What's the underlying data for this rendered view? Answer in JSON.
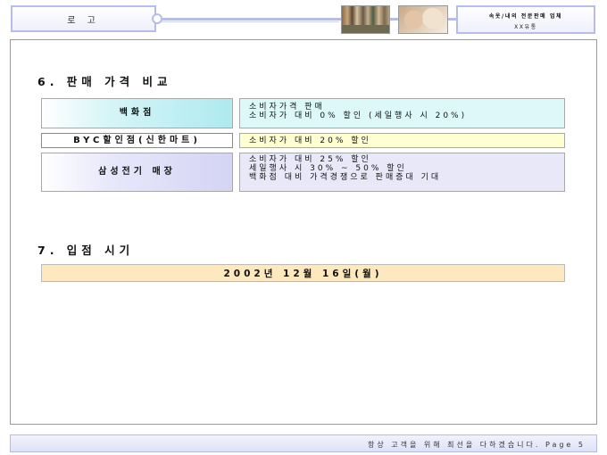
{
  "header": {
    "logo": "로 고",
    "title_line1": "속옷/내의 전문판매 업체",
    "title_line2": "XX유통",
    "photo1": "group-photo",
    "photo2": "couple-photo"
  },
  "section6": {
    "title": "6. 판매 가격 비교",
    "rows": [
      {
        "label": "백화점",
        "lines": [
          "소비자가격 판매",
          "소비자가 대비 0% 할인 (세일행사 시 20%)"
        ]
      },
      {
        "label": "BYC할인점(신한마트)",
        "lines": [
          "소비자가 대비 20% 할인"
        ]
      },
      {
        "label": "삼성전기 매장",
        "lines": [
          "소비자가 대비 25% 할인",
          "세일행사 시 30% ~ 50% 할인",
          "백화점 대비 가격경쟁으로 판매증대 기대"
        ]
      }
    ]
  },
  "section7": {
    "title": "7. 입점 시기",
    "date": "2002년 12월 16일(월)"
  },
  "footer": {
    "text": "항상 고객을 위해 최선을 다하겠습니다. Page 5"
  }
}
